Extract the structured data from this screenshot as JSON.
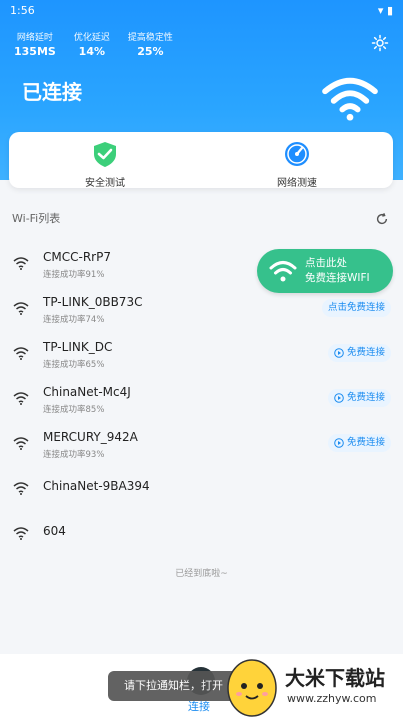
{
  "status": {
    "time": "1:56",
    "icons": "▾ ▮"
  },
  "metrics": [
    {
      "label": "网络延时",
      "value": "135MS"
    },
    {
      "label": "优化延迟",
      "value": "14%"
    },
    {
      "label": "提高稳定性",
      "value": "25%"
    }
  ],
  "header": {
    "connected": "已连接"
  },
  "quick_actions": [
    {
      "label": "安全测试",
      "icon": "shield-check-icon"
    },
    {
      "label": "网络测速",
      "icon": "speedometer-icon"
    }
  ],
  "wifi_list": {
    "title": "Wi-Fi列表",
    "items": [
      {
        "name": "CMCC-RrP7",
        "sub": "连接成功率91%",
        "button": ""
      },
      {
        "name": "TP-LINK_0BB73C",
        "sub": "连接成功率74%",
        "button": "点击免费连接"
      },
      {
        "name": "TP-LINK_DC",
        "sub": "连接成功率65%",
        "button": "免费连接"
      },
      {
        "name": "ChinaNet-Mc4J",
        "sub": "连接成功率85%",
        "button": "免费连接"
      },
      {
        "name": "MERCURY_942A",
        "sub": "连接成功率93%",
        "button": "免费连接"
      },
      {
        "name": "ChinaNet-9BA394",
        "sub": "",
        "button": ""
      },
      {
        "name": "604",
        "sub": "",
        "button": ""
      }
    ],
    "end_text": "已经到底啦~"
  },
  "tooltip": {
    "line1": "点击此处",
    "line2": "免费连接WIFI"
  },
  "bottom_nav": {
    "label": "连接"
  },
  "toast": "请下拉通知栏，打开",
  "watermark": {
    "title": "大米下载站",
    "url": "www.zzhyw.com"
  },
  "colors": {
    "primary": "#1e95ff",
    "tooltip": "#36c18c",
    "button_bg": "#e9f4ff",
    "button_text": "#1b8cf0"
  }
}
